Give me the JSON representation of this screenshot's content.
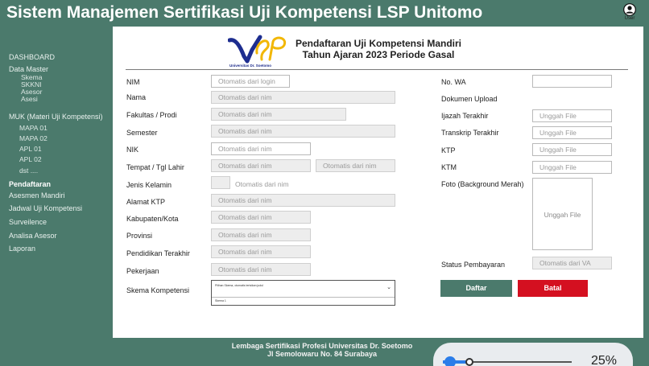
{
  "header": {
    "app_title": "Sistem Manajemen Sertifikasi Uji Kompetensi LSP Unitomo",
    "user_label": "User"
  },
  "sidebar": {
    "items": [
      {
        "label": "DASHBOARD"
      },
      {
        "label": "Data Master"
      },
      {
        "label": "Skema"
      },
      {
        "label": "SKKNI"
      },
      {
        "label": "Asesor"
      },
      {
        "label": "Asesi"
      },
      {
        "label": "MUK (Materi Uji Kompetensi)"
      },
      {
        "label": "MAPA 01"
      },
      {
        "label": "MAPA 02"
      },
      {
        "label": "APL 01"
      },
      {
        "label": "APL 02"
      },
      {
        "label": "dst ...."
      },
      {
        "label": "Pendaftaran"
      },
      {
        "label": "Asesmen Mandiri"
      },
      {
        "label": "Jadwal Uji Kompetensi"
      },
      {
        "label": "Surveilence"
      },
      {
        "label": "Analisa Asesor"
      },
      {
        "label": "Laporan"
      }
    ]
  },
  "logo": {
    "subtitle": "Universitas Dr. Soetomo"
  },
  "form_header": {
    "line1": "Pendaftaran Uji Kompetensi  Mandiri",
    "line2": "Tahun Ajaran 2023 Periode Gasal"
  },
  "left_form": {
    "nim": {
      "label": "NIM",
      "value": "Otomatis dari login"
    },
    "nama": {
      "label": "Nama",
      "value": "Otomatis dari nim"
    },
    "fakultas": {
      "label": "Fakultas / Prodi",
      "value": "Otomatis dari nim"
    },
    "semester": {
      "label": "Semester",
      "value": "Otomatis dari nim"
    },
    "nik": {
      "label": "NIK",
      "value": "Otomatis dari nim"
    },
    "ttl": {
      "label": "Tempat / Tgl Lahir",
      "value1": "Otomatis dari nim",
      "value2": "Otomatis dari nim"
    },
    "jk": {
      "label": "Jenis Kelamin",
      "value": "Otomatis dari nim"
    },
    "alamat": {
      "label": "Alamat KTP",
      "value": "Otomatis dari nim"
    },
    "kabupaten": {
      "label": "Kabupaten/Kota",
      "value": "Otomatis dari nim"
    },
    "provinsi": {
      "label": "Provinsi",
      "value": "Otomatis dari nim"
    },
    "pendidikan": {
      "label": "Pendidikan Terakhir",
      "value": "Otomatis dari nim"
    },
    "pekerjaan": {
      "label": "Pekerjaan",
      "value": "Otomatis dari nim"
    },
    "skema": {
      "label": "Skema Kompetensi",
      "placeholder": "Pilihan Skema, otomatis terisikan judul",
      "option": "Skema 1"
    }
  },
  "right_form": {
    "wa": {
      "label": "No. WA",
      "value": ""
    },
    "dokumen": {
      "label": "Dokumen Upload"
    },
    "ijazah": {
      "label": "Ijazah Terakhir",
      "value": "Unggah File"
    },
    "transkrip": {
      "label": "Transkrip Terakhir",
      "value": "Unggah File"
    },
    "ktp": {
      "label": "KTP",
      "value": "Unggah File"
    },
    "ktm": {
      "label": "KTM",
      "value": "Unggah File"
    },
    "foto": {
      "label": "Foto (Background Merah)",
      "value": "Unggah File"
    },
    "status": {
      "label": "Status Pembayaran",
      "value": "Otomatis dari  VA"
    }
  },
  "buttons": {
    "daftar": "Daftar",
    "batal": "Batal"
  },
  "footer": {
    "line1": "Lembaga Sertifikasi Profesi Universitas Dr. Soetomo",
    "line2": "Jl Semolowaru No. 84 Surabaya"
  },
  "zoom": {
    "label": "25%",
    "level": 0.25
  },
  "colors": {
    "primary": "#4b7a6c",
    "danger": "#d41020",
    "accent": "#2b7de9"
  }
}
